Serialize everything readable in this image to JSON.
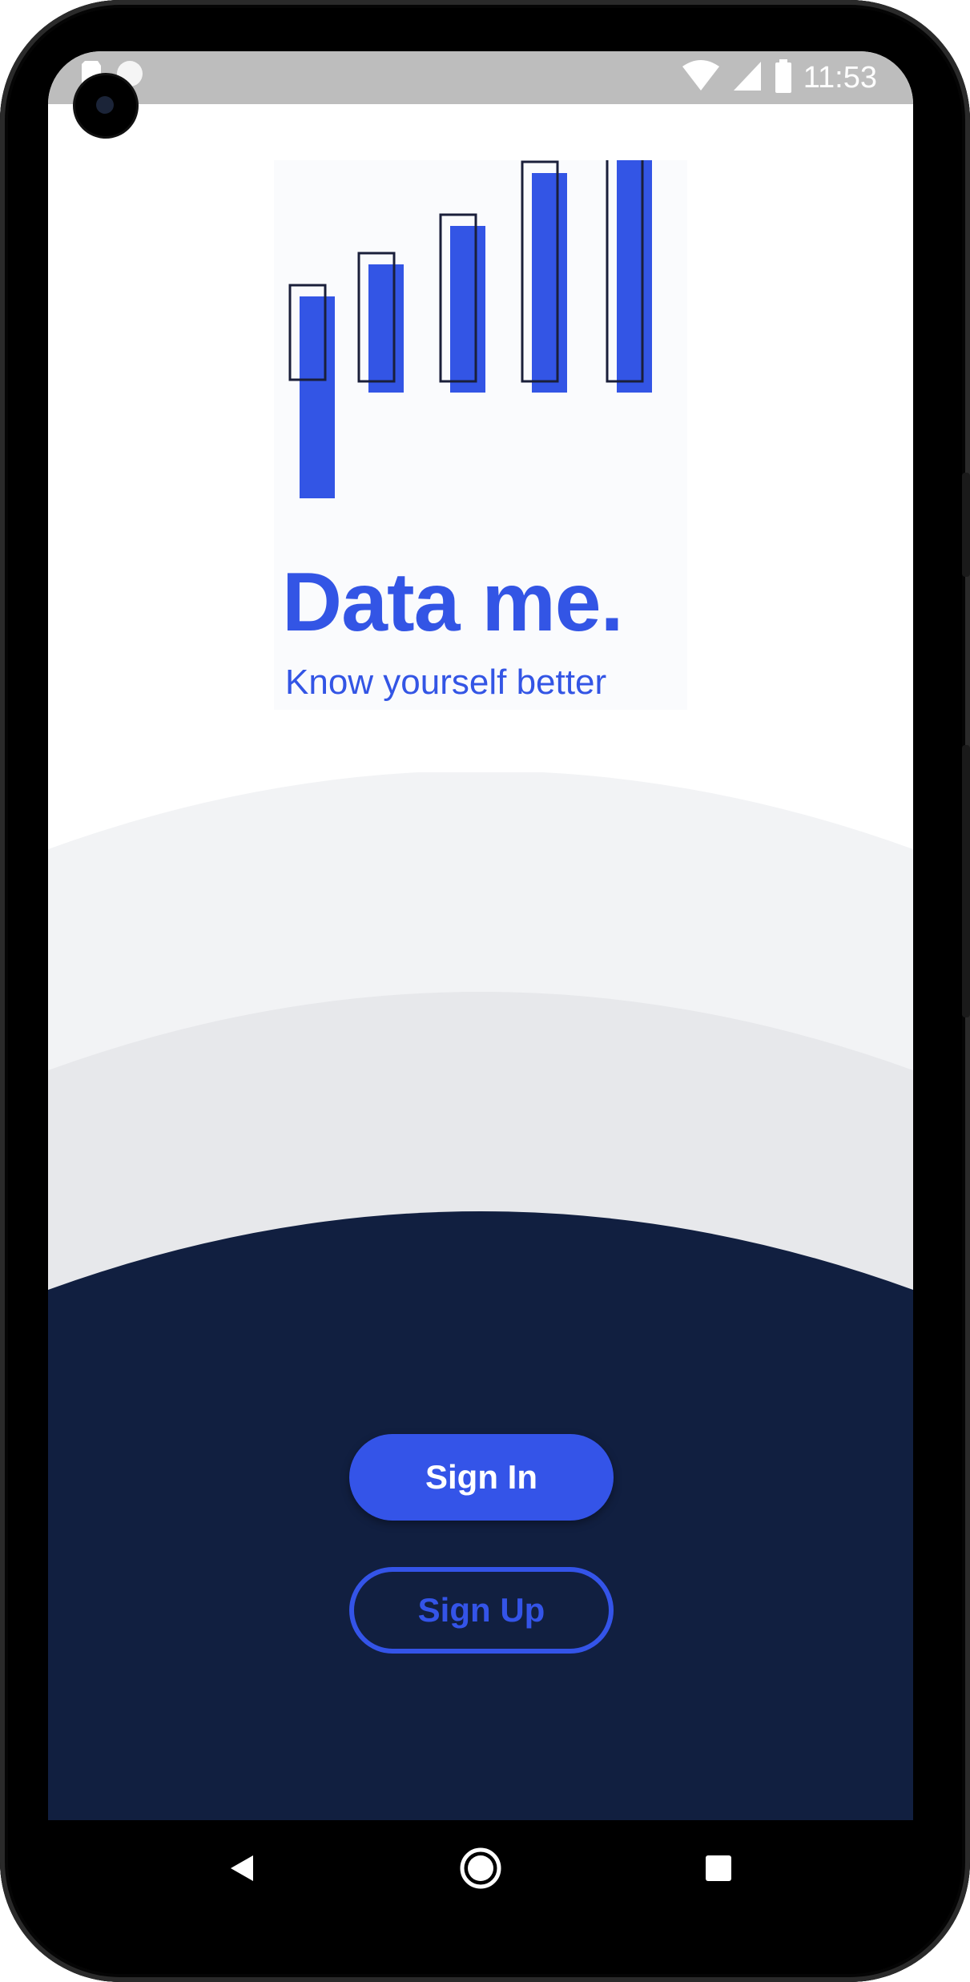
{
  "status_bar": {
    "time": "11:53"
  },
  "logo": {
    "title": "Data me.",
    "tagline": "Know yourself better",
    "accent_color": "#3355e5"
  },
  "actions": {
    "sign_in_label": "Sign In",
    "sign_up_label": "Sign Up"
  },
  "theme": {
    "dark_panel": "#111f40",
    "wave_light": "#f2f3f5",
    "wave_mid": "#e7e8eb",
    "primary": "#3454e8"
  },
  "nav": {
    "icons": [
      "back-icon",
      "home-icon",
      "recents-icon"
    ]
  }
}
